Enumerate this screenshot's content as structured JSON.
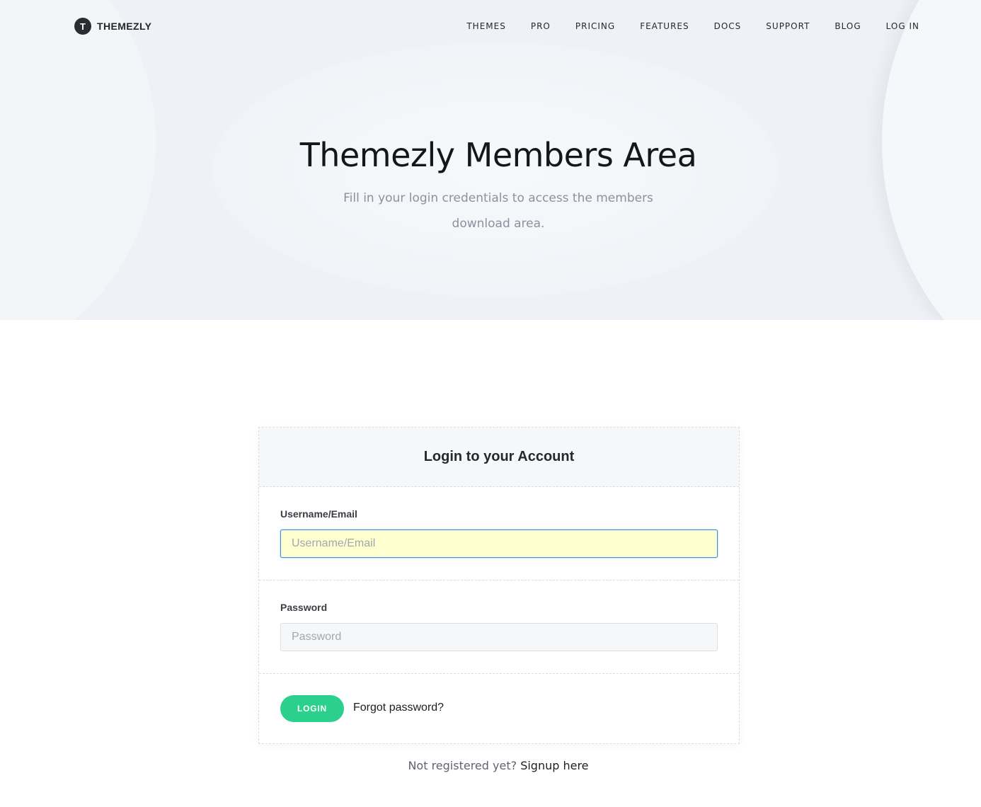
{
  "brand": {
    "name": "THEMEZLY",
    "mark": "T"
  },
  "nav": {
    "items": [
      "THEMES",
      "PRO",
      "PRICING",
      "FEATURES",
      "DOCS",
      "SUPPORT",
      "BLOG",
      "LOG IN"
    ]
  },
  "hero": {
    "title": "Themezly Members Area",
    "subtitle": "Fill in your login credentials to access the members download area."
  },
  "login": {
    "heading": "Login to your Account",
    "username_label": "Username/Email",
    "username_placeholder": "Username/Email",
    "username_value": "",
    "password_label": "Password",
    "password_placeholder": "Password",
    "password_value": "",
    "submit_label": "LOGIN",
    "forgot_label": "Forgot password?"
  },
  "register": {
    "prompt": "Not registered yet?",
    "link": "Signup here"
  },
  "colors": {
    "accent": "#2bd08c",
    "hero_bg": "#eef1f6",
    "autofill_bg": "#ffffd0",
    "focus_border": "#3d8fe0"
  }
}
